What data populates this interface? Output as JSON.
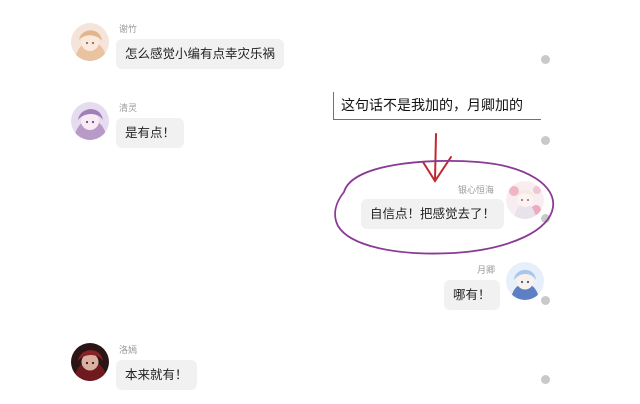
{
  "messages": [
    {
      "name": "谢竹",
      "text": "怎么感觉小编有点幸灾乐祸"
    },
    {
      "name": "清灵",
      "text": "是有点！"
    },
    {
      "name": "银心恒海",
      "text": "自信点！把感觉去了！"
    },
    {
      "name": "月卿",
      "text": "哪有！"
    },
    {
      "name": "洛嫣",
      "text": "本来就有！"
    }
  ],
  "annotation": {
    "text": "这句话不是我加的，月卿加的",
    "underline_color": "#2f9a4a",
    "arrow_color": "#c0282f",
    "circle_color": "#8a3a96"
  },
  "icons": {
    "status_dot": "status-dot-icon"
  }
}
